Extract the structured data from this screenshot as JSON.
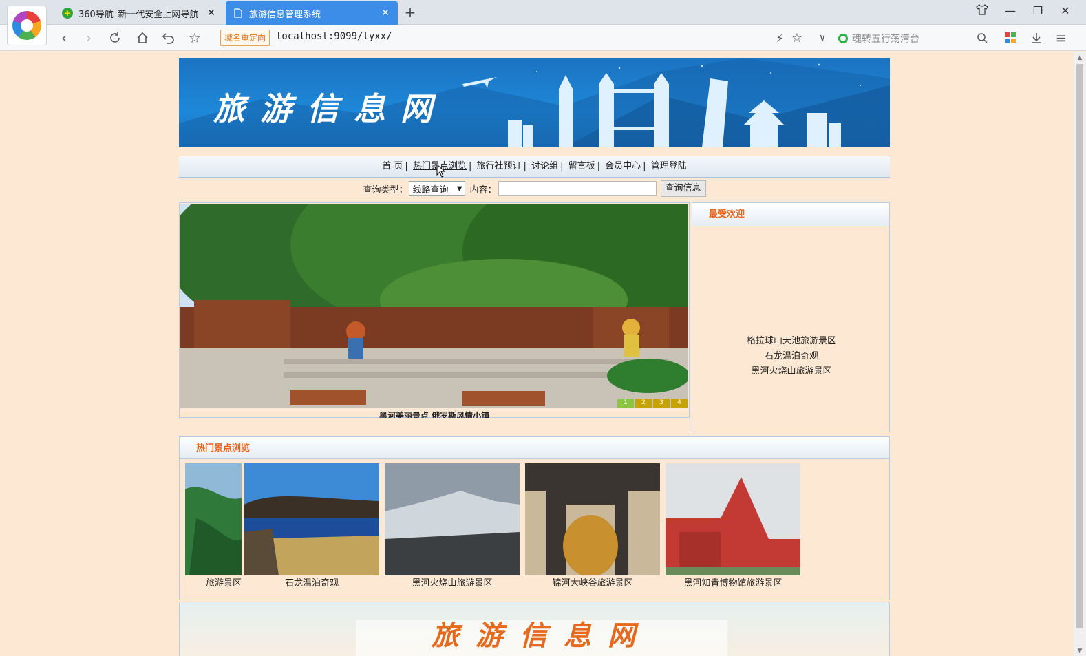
{
  "browser": {
    "tabs": [
      {
        "title": "360导航_新一代安全上网导航",
        "active": false
      },
      {
        "title": "旅游信息管理系统",
        "active": true
      }
    ],
    "redirect_badge": "域名重定向",
    "url": "localhost:9099/lyxx/",
    "search_placeholder": "魂转五行荡清台"
  },
  "site": {
    "banner_title": "旅游信息网",
    "menu": [
      {
        "label": "首 页",
        "active": false
      },
      {
        "label": "热门景点浏览",
        "active": true
      },
      {
        "label": "旅行社预订",
        "active": false
      },
      {
        "label": "讨论组",
        "active": false
      },
      {
        "label": "留言板",
        "active": false
      },
      {
        "label": "会员中心",
        "active": false
      },
      {
        "label": "管理登陆",
        "active": false
      }
    ],
    "query": {
      "type_label": "查询类型：",
      "type_value": "线路查询",
      "content_label": "内容：",
      "content_value": "",
      "button": "查询信息"
    },
    "slideshow": {
      "caption": "黑河美丽景点 俄罗斯风情小镇",
      "pages": [
        "1",
        "2",
        "3",
        "4"
      ],
      "active_page": 1
    },
    "popular": {
      "title": "最受欢迎",
      "items": [
        "格拉球山天池旅游景区",
        "石龙温泊奇观",
        "黑河火烧山旅游景区"
      ]
    },
    "hot": {
      "title": "热门景点浏览",
      "items": [
        {
          "label": "旅游景区"
        },
        {
          "label": "石龙温泊奇观"
        },
        {
          "label": "黑河火烧山旅游景区"
        },
        {
          "label": "锦河大峡谷旅游景区"
        },
        {
          "label": "黑河知青博物馆旅游景区"
        }
      ]
    },
    "footer_title": "旅游信息网"
  }
}
